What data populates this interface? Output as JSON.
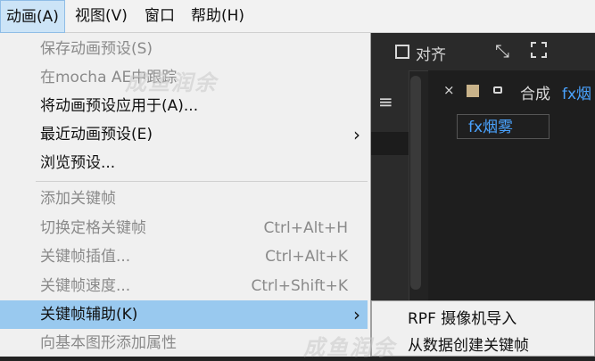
{
  "menubar": {
    "items": [
      {
        "label": "动画(A)",
        "active": true
      },
      {
        "label": "视图(V)"
      },
      {
        "label": "窗口"
      },
      {
        "label": "帮助(H)"
      }
    ]
  },
  "background": {
    "align_label": "对齐",
    "comp_label": "合成",
    "comp_fx": "fx烟",
    "effect_tag": "fx烟雾",
    "close_glyph": "×",
    "lock_glyph": "🔓",
    "menu_glyph": "≡"
  },
  "menu": {
    "items": [
      {
        "label": "保存动画预设(S)",
        "state": "disabled"
      },
      {
        "label": "在mocha AE中跟踪",
        "state": "disabled"
      },
      {
        "label": "将动画预设应用于(A)...",
        "state": "enabled"
      },
      {
        "label": "最近动画预设(E)",
        "state": "enabled",
        "submenu": true
      },
      {
        "label": "浏览预设...",
        "state": "enabled"
      },
      {
        "label": "添加关键帧",
        "state": "disabled"
      },
      {
        "label": "切换定格关键帧",
        "shortcut": "Ctrl+Alt+H",
        "state": "disabled"
      },
      {
        "label": "关键帧插值...",
        "shortcut": "Ctrl+Alt+K",
        "state": "disabled"
      },
      {
        "label": "关键帧速度...",
        "shortcut": "Ctrl+Shift+K",
        "state": "disabled"
      },
      {
        "label": "关键帧辅助(K)",
        "state": "highlighted",
        "submenu": true
      },
      {
        "label": "向基本图形添加属性",
        "state": "disabled"
      }
    ],
    "arrow_glyph": "›"
  },
  "submenu": {
    "items": [
      {
        "label": "RPF 摄像机导入"
      },
      {
        "label": "从数据创建关键帧"
      }
    ]
  },
  "watermark": {
    "text_top": "成鱼润余",
    "text_bottom": "成鱼润余"
  },
  "colors": {
    "menu_bg": "#f0f0f0",
    "highlight": "#99c9ef",
    "disabled_text": "#8a8a8a",
    "accent_blue": "#4aa3ff",
    "dark_bg": "#232323"
  }
}
